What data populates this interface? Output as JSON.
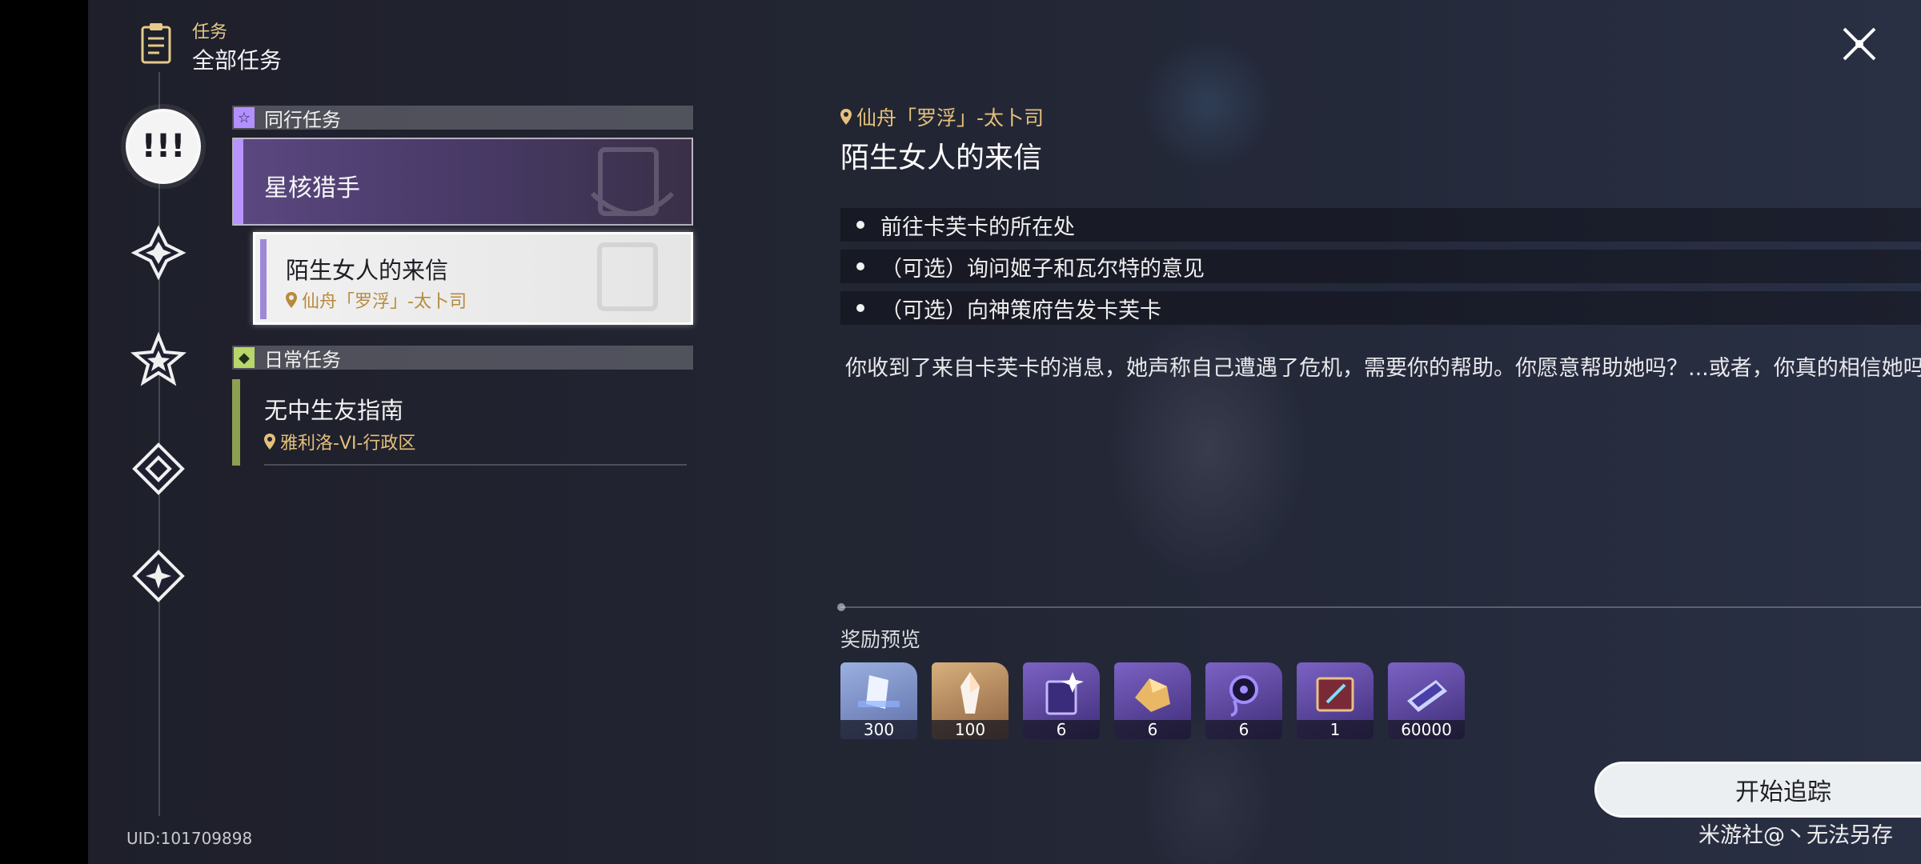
{
  "header": {
    "category": "任务",
    "title": "全部任务"
  },
  "sidebar": {
    "uid": "UID:101709898",
    "categories": [
      {
        "icon": "exclamation-icon",
        "active": true
      },
      {
        "icon": "diamond-star-icon",
        "active": false
      },
      {
        "icon": "star-icon",
        "active": false
      },
      {
        "icon": "diamond-icon",
        "active": false
      },
      {
        "icon": "diamond-sparkle-icon",
        "active": false
      }
    ]
  },
  "mission_list": {
    "companion_section": "同行任务",
    "companion_parent": "星核猎手",
    "selected_mission": {
      "title": "陌生女人的来信",
      "location": "仙舟「罗浮」-太卜司"
    },
    "daily_section": "日常任务",
    "daily_mission": {
      "title": "无中生友指南",
      "location": "雅利洛-VI-行政区"
    }
  },
  "detail": {
    "location": "仙舟「罗浮」-太卜司",
    "title": "陌生女人的来信",
    "objectives": [
      "前往卡芙卡的所在处",
      "（可选）询问姬子和瓦尔特的意见",
      "（可选）向神策府告发卡芙卡"
    ],
    "description": "你收到了来自卡芙卡的消息，她声称自己遭遇了危机，需要你的帮助。你愿意帮助她吗？...或者，你真的相信她吗？",
    "reward_header": "奖励预览",
    "rewards": [
      {
        "icon": "exp-material-icon",
        "count": "300",
        "color": "#7f93c9"
      },
      {
        "icon": "crystal-icon",
        "count": "100",
        "color": "#c39767"
      },
      {
        "icon": "book-icon",
        "count": "6",
        "color": "#5b47a0"
      },
      {
        "icon": "gold-ore-icon",
        "count": "6",
        "color": "#6a5da8"
      },
      {
        "icon": "relic-icon",
        "count": "6",
        "color": "#5b4a9c"
      },
      {
        "icon": "tome-icon",
        "count": "1",
        "color": "#4d3e8a"
      },
      {
        "icon": "credit-icon",
        "count": "60000",
        "color": "#574c9f"
      }
    ],
    "track_button": "开始追踪"
  },
  "watermark": "米游社@丶无法另存"
}
